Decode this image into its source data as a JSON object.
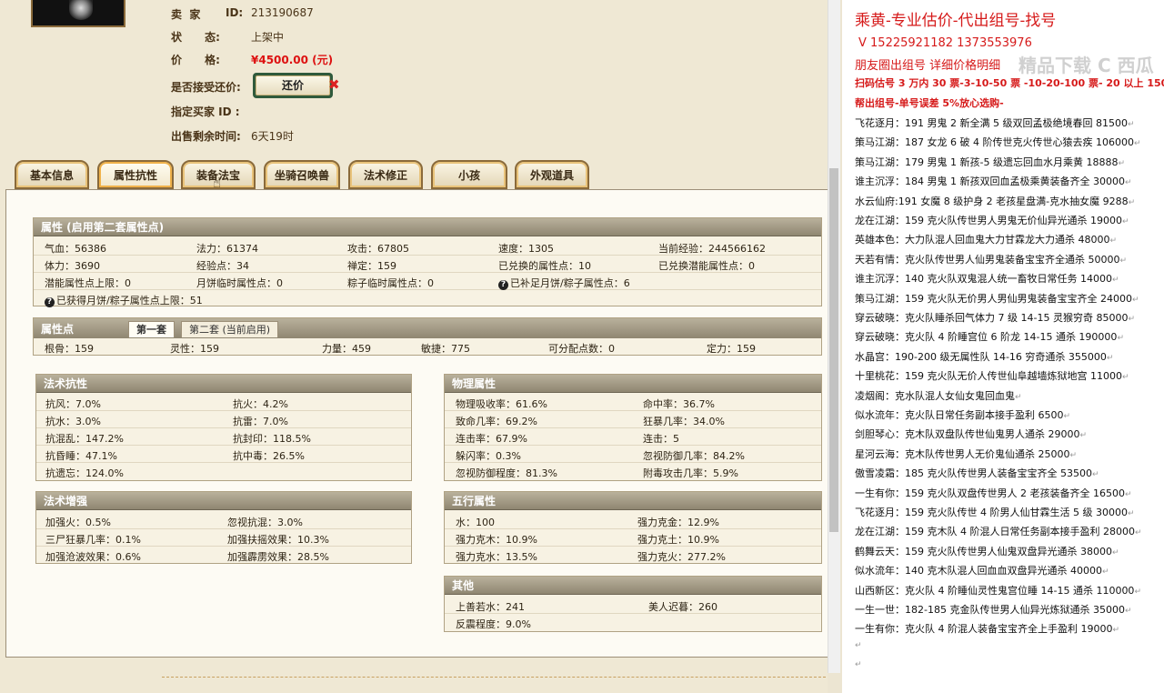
{
  "seller": {
    "label": "卖  家",
    "id_label": "ID:",
    "id": "213190687"
  },
  "status": {
    "label": "状      态:",
    "value": "上架中"
  },
  "price": {
    "label": "价      格:",
    "value": "¥4500.00 (元)"
  },
  "counter_offer": {
    "label": "是否接受还价:",
    "button": "还价",
    "close": "✖"
  },
  "buyer": {
    "label": "指定买家 ID :"
  },
  "remaining": {
    "label": "出售剩余时间:",
    "value": "6天19时"
  },
  "tabs": [
    "基本信息",
    "属性抗性",
    "装备法宝",
    "坐骑召唤兽",
    "法术修正",
    "小孩",
    "外观道具"
  ],
  "attr": {
    "header": "属性 (启用第二套属性点)",
    "rows": [
      [
        "气血：56386",
        "法力：61374",
        "攻击：67805",
        "速度：1305",
        "当前经验：244566162"
      ],
      [
        "体力：3690",
        "经验点：34",
        "禅定：159",
        "已兑换的属性点：10",
        "已兑换潜能属性点：0"
      ],
      [
        "潜能属性点上限：0",
        "月饼临时属性点：0",
        "粽子临时属性点：0",
        "已补足月饼/粽子属性点：6"
      ]
    ],
    "note": "已获得月饼/粽子属性点上限：51"
  },
  "points": {
    "header": "属性点",
    "subtabs": [
      "第一套",
      "第二套 (当前启用)"
    ],
    "values": [
      "根骨：159",
      "灵性：159",
      "力量：459",
      "敏捷：775",
      "可分配点数：0",
      "定力：159"
    ]
  },
  "spell_resist": {
    "header": "法术抗性",
    "rows": [
      [
        "抗风：7.0%",
        "抗火：4.2%"
      ],
      [
        "抗水：3.0%",
        "抗雷：7.0%"
      ],
      [
        "抗混乱：147.2%",
        "抗封印：118.5%"
      ],
      [
        "抗昏睡：47.1%",
        "抗中毒：26.5%"
      ],
      [
        "抗遗忘：124.0%",
        ""
      ]
    ]
  },
  "physical": {
    "header": "物理属性",
    "rows": [
      [
        "物理吸收率：61.6%",
        "命中率：36.7%"
      ],
      [
        "致命几率：69.2%",
        "狂暴几率：34.0%"
      ],
      [
        "连击率：67.9%",
        "连击：5"
      ],
      [
        "躲闪率：0.3%",
        "忽视防御几率：84.2%"
      ],
      [
        "忽视防御程度：81.3%",
        "附毒攻击几率：5.9%"
      ]
    ]
  },
  "spell_boost": {
    "header": "法术增强",
    "rows": [
      [
        "加强火：0.5%",
        "忽视抗混：3.0%"
      ],
      [
        "三尸狂暴几率：0.1%",
        "加强扶摇效果：10.3%"
      ],
      [
        "加强沧波效果：0.6%",
        "加强霹雳效果：28.5%"
      ]
    ]
  },
  "elements": {
    "header": "五行属性",
    "rows": [
      [
        "水：100",
        "强力克金：12.9%"
      ],
      [
        "强力克木：10.9%",
        "强力克土：10.9%"
      ],
      [
        "强力克水：13.5%",
        "强力克火：277.2%"
      ]
    ]
  },
  "other": {
    "header": "其他",
    "rows": [
      [
        "上善若水：241",
        "美人迟暮：260"
      ],
      [
        "反震程度：9.0%",
        ""
      ]
    ]
  },
  "sidebar": {
    "title": "乘黄-专业估价-代出组号-找号",
    "contact": "V 15225921182   1373553976",
    "friends": "朋友圈出组号    详细价格明细",
    "rate": "扫码估号 3 万内 30 票-3-10-50 票  -10-20-100 票- 20 以上 150",
    "help": "帮出组号-单号误差 5%放心选购-",
    "watermark": "精品下载    C 西瓜",
    "listings": [
      "飞花逐月：191 男鬼 2 新全满 5 级双回孟极绝境春回 81500",
      "策马江湖：187 女龙 6 破 4 阶传世克火传世心猿去疾 106000",
      "策马江湖：179 男鬼 1 新孩-5 级遗忘回血水月乘黄 18888",
      "谁主沉浮：184 男鬼 1 新孩双回血孟极乘黄装备齐全 30000",
      "水云仙府:191 女魔 8 级护身 2 老孩星盘满-克水抽女魔 9288",
      "龙在江湖：159 克火队传世男人男鬼无价仙异光通杀 19000",
      "英雄本色：大力队混人回血鬼大力甘霖龙大力通杀 48000",
      "天若有情：克火队传世男人仙男鬼装备宝宝齐全通杀 50000",
      "谁主沉浮：140 克火队双鬼混人统一畜牧日常任务 14000",
      "策马江湖：159 克火队无价男人男仙男鬼装备宝宝齐全 24000",
      "穿云破晓：克火队睡杀回气体力 7 级 14-15 灵猴穷奇 85000",
      "穿云破晓：克火队 4 阶睡宫位 6 阶龙 14-15 通杀 190000",
      "水晶宫：190-200 级无属性队 14-16 穷奇通杀 355000",
      "十里桃花：159 克火队无价人传世仙阜越墙炼狱地宫 11000",
      "凌烟阁：克水队混人女仙女鬼回血鬼",
      "似水流年：克火队日常任务副本接手盈利 6500",
      "剑胆琴心：克木队双盘队传世仙鬼男人通杀 29000",
      "星河云海：克木队传世男人无价鬼仙通杀 25000",
      "傲雪凌霜：185 克火队传世男人装备宝宝齐全 53500",
      "一生有你：159 克火队双盘传世男人 2 老孩装备齐全 16500",
      "飞花逐月：159 克火队传世 4 阶男人仙甘霖生活 5 级 30000",
      "龙在江湖：159 克木队 4 阶混人日常任务副本接手盈利 28000",
      "鹤舞云天：159 克火队传世男人仙鬼双盘异光通杀 38000",
      "似水流年：140 克木队混人回血血双盘异光通杀 40000",
      "山西新区：克火队 4 阶睡仙灵性鬼宫位睡 14-15 通杀 110000",
      "一生一世：182-185 克金队传世男人仙异光炼狱通杀 35000",
      "一生有你：克火队 4 阶混人装备宝宝齐全上手盈利 19000"
    ],
    "return_mark": "↵"
  }
}
